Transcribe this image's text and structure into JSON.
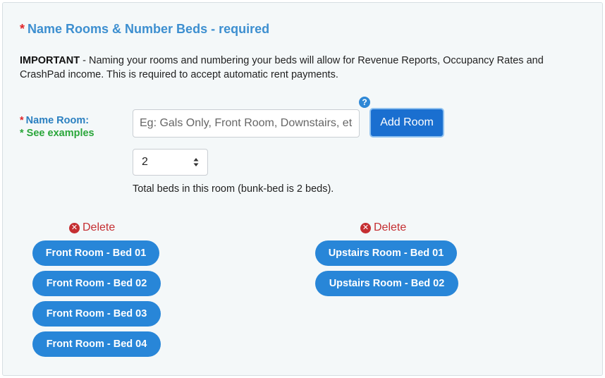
{
  "header": {
    "required_star": "*",
    "title": "Name Rooms & Number Beds - required"
  },
  "notice": {
    "bold": "IMPORTANT",
    "text": " - Naming your rooms and numbering your beds will allow for Revenue Reports, Occupancy Rates and CrashPad income. This is required to accept automatic rent payments."
  },
  "form": {
    "name_label_star": "*",
    "name_label": "Name Room:",
    "examples_link": "* See examples",
    "room_input_placeholder": "Eg: Gals Only, Front Room, Downstairs, etc",
    "room_input_value": "",
    "help_icon_glyph": "?",
    "add_button_label": "Add Room",
    "beds_selected": "2",
    "beds_hint": "Total beds in this room (bunk-bed is 2 beds)."
  },
  "rooms": [
    {
      "delete_glyph": "✕",
      "delete_label": "Delete",
      "beds": [
        "Front Room - Bed 01",
        "Front Room - Bed 02",
        "Front Room - Bed 03",
        "Front Room - Bed 04"
      ]
    },
    {
      "delete_glyph": "✕",
      "delete_label": "Delete",
      "beds": [
        "Upstairs Room - Bed 01",
        "Upstairs Room - Bed 02"
      ]
    }
  ],
  "colors": {
    "accent": "#2886d8",
    "button": "#1a6fd0",
    "required": "#e0262b",
    "examples": "#2aa63a",
    "delete": "#c52f32"
  }
}
